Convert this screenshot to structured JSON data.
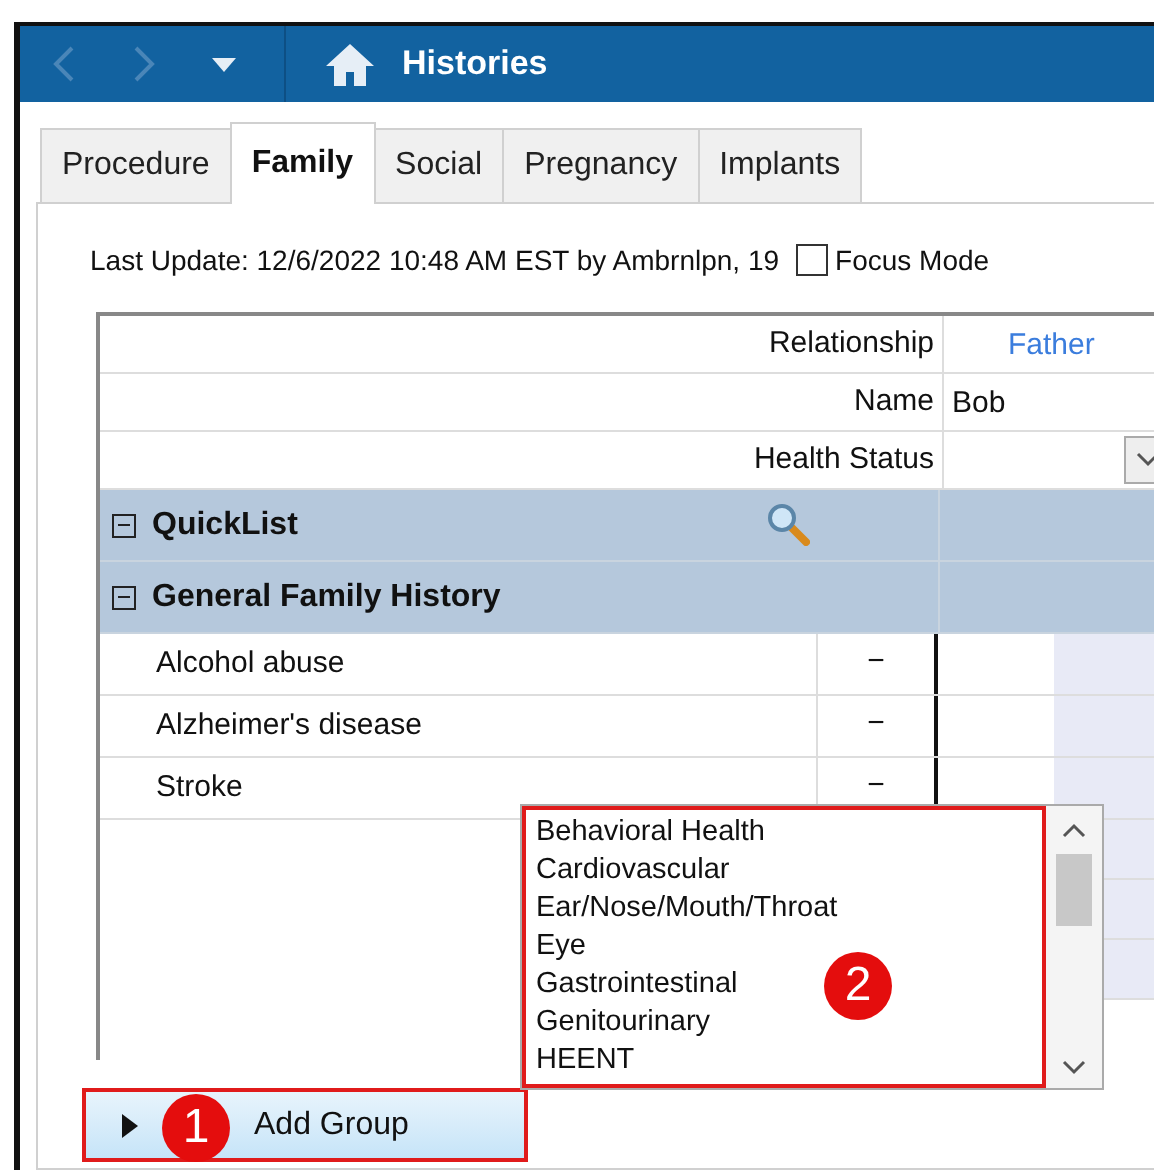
{
  "window": {
    "title": "Histories"
  },
  "tabs": [
    {
      "label": "Procedure",
      "selected": false
    },
    {
      "label": "Family",
      "selected": true
    },
    {
      "label": "Social",
      "selected": false
    },
    {
      "label": "Pregnancy",
      "selected": false
    },
    {
      "label": "Implants",
      "selected": false
    }
  ],
  "last_update": "Last Update: 12/6/2022 10:48 AM EST by Ambrnlpn, 19",
  "focus_mode": {
    "label": "Focus Mode",
    "checked": false
  },
  "header_rows": [
    {
      "label": "Relationship",
      "kind": "link",
      "value": "Father"
    },
    {
      "label": "Name",
      "kind": "text",
      "value": "Bob"
    },
    {
      "label": "Health Status",
      "kind": "dropdown"
    }
  ],
  "groups": [
    {
      "title": "QuickList",
      "kind": "search",
      "expanded": true
    },
    {
      "title": "General Family History",
      "kind": "plain",
      "expanded": true,
      "items": [
        {
          "name": "Alcohol abuse",
          "mark": "−"
        },
        {
          "name": "Alzheimer's disease",
          "mark": "−"
        },
        {
          "name": "Stroke",
          "mark": "−"
        }
      ]
    }
  ],
  "group_list": {
    "items": [
      "Behavioral Health",
      "Cardiovascular",
      "Ear/Nose/Mouth/Throat",
      "Eye",
      "Gastrointestinal",
      "Genitourinary",
      "HEENT"
    ]
  },
  "add_group": {
    "label": "Add Group"
  },
  "callouts": [
    "1",
    "2"
  ]
}
